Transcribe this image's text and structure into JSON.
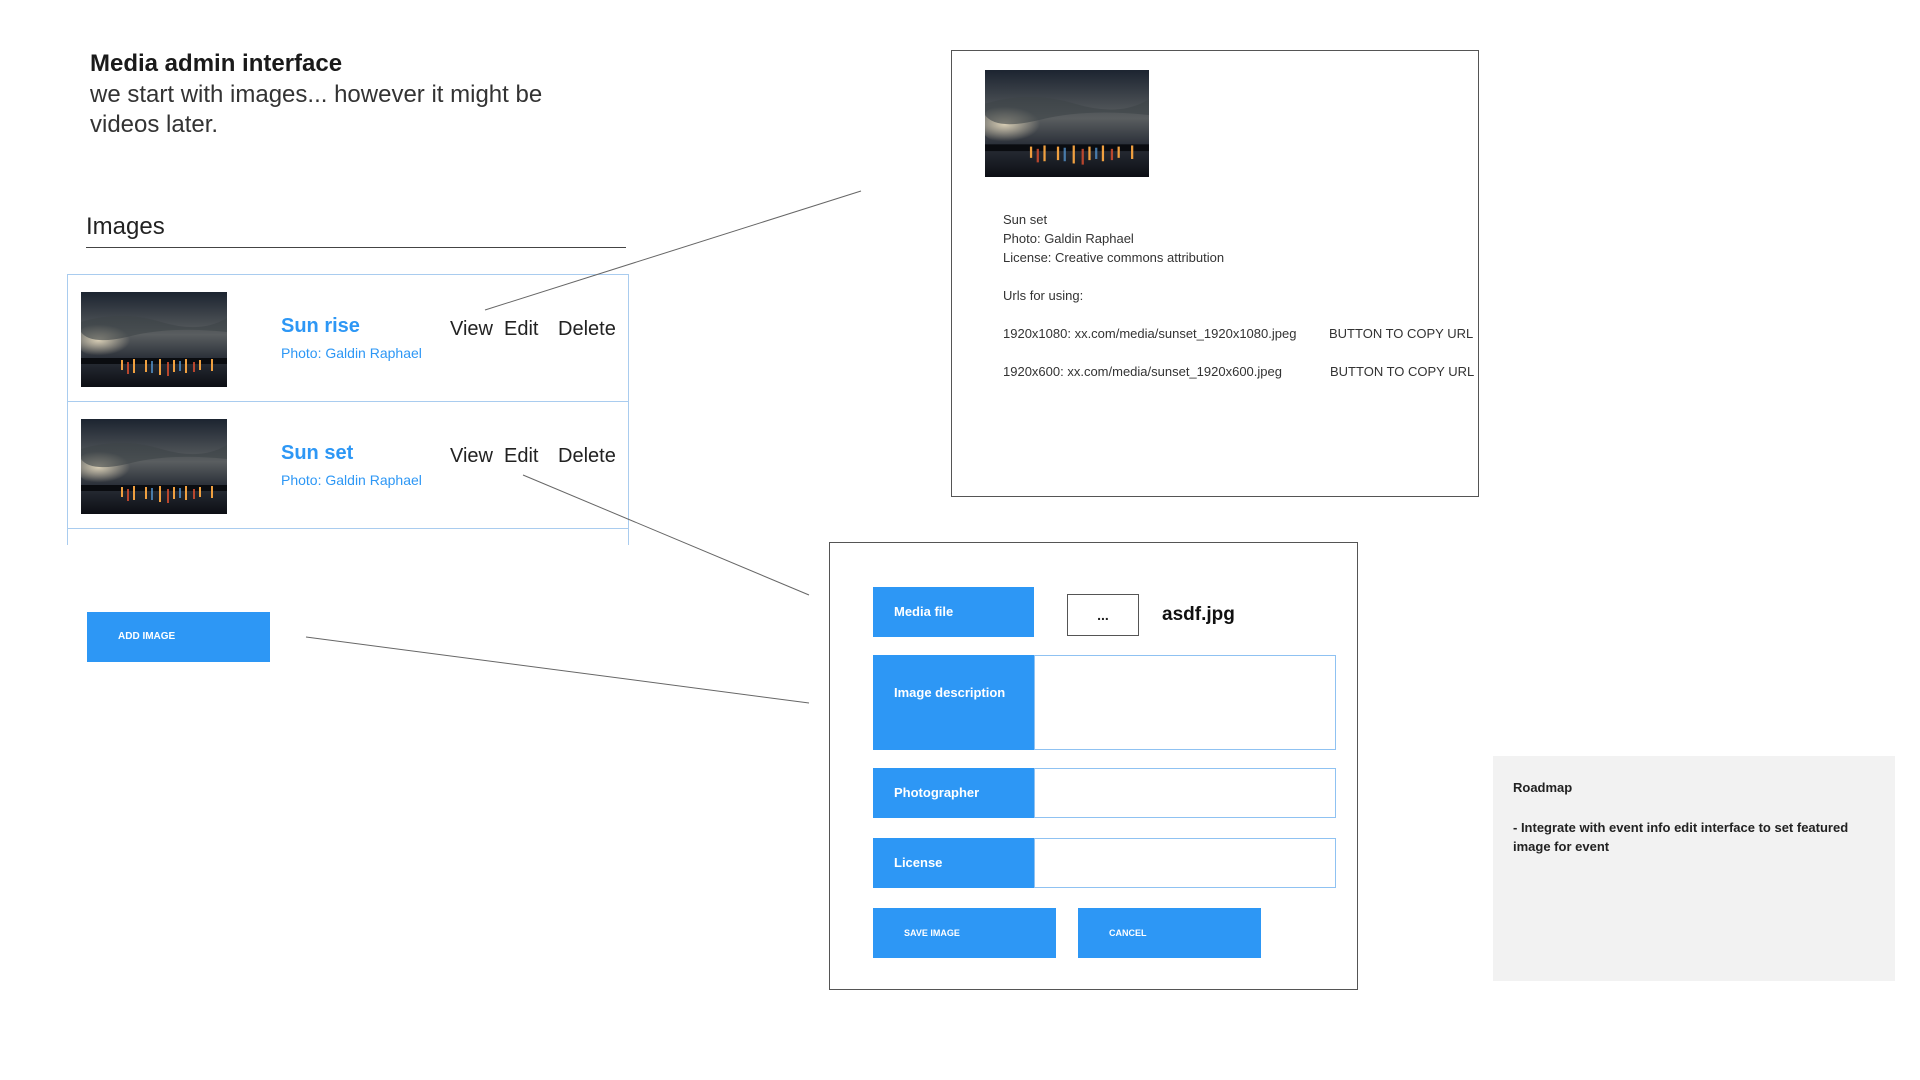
{
  "header": {
    "title": "Media admin interface",
    "subtitle": "we start with images... however it might be videos later."
  },
  "images_section": {
    "title": "Images",
    "rows": [
      {
        "title": "Sun rise",
        "credit": "Photo: Galdin Raphael",
        "view": "View",
        "edit": "Edit",
        "delete": "Delete"
      },
      {
        "title": "Sun set",
        "credit": "Photo: Galdin Raphael",
        "view": "View",
        "edit": "Edit",
        "delete": "Delete"
      }
    ],
    "add_button": "ADD IMAGE"
  },
  "view_panel": {
    "title_line": "Sun set",
    "photo_line": "Photo: Galdin Raphael",
    "license_line": "License: Creative commons attribution",
    "urls_heading": "Urls for using:",
    "urls": [
      {
        "text": "1920x1080: xx.com/media/sunset_1920x1080.jpeg",
        "button": "BUTTON TO COPY URL"
      },
      {
        "text": "1920x600: xx.com/media/sunset_1920x600.jpeg",
        "button": "BUTTON TO COPY URL"
      }
    ]
  },
  "edit_panel": {
    "media_file_label": "Media file",
    "browse_label": "...",
    "file_name": "asdf.jpg",
    "description_label": "Image description",
    "photographer_label": "Photographer",
    "license_label": "License",
    "save_button": "SAVE IMAGE",
    "cancel_button": "CANCEL"
  },
  "roadmap": {
    "title": "Roadmap",
    "item": "- Integrate with event info edit interface to set featured image for event"
  },
  "colors": {
    "accent": "#2d97f5",
    "row_border": "#a9ccef",
    "roadmap_bg": "#f2f2f2"
  }
}
